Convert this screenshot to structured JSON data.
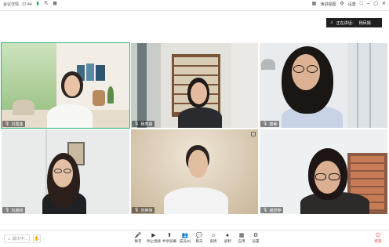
{
  "titlebar": {
    "meeting_label": "会议详情",
    "time": "37:44",
    "right_view_label": "演讲视图",
    "right_settings_label": "设置"
  },
  "speaking": {
    "label": "正在讲话：",
    "name": "杨凤娟"
  },
  "participants": [
    {
      "name": "刘霞莲"
    },
    {
      "name": "杨秀娟"
    },
    {
      "name": "唐睿"
    },
    {
      "name": "刘晨晓"
    },
    {
      "name": "刘英伟"
    },
    {
      "name": "谢舒婷"
    }
  ],
  "toolbar": {
    "chat_placeholder": "聊天中...",
    "tools": [
      {
        "label": "静音",
        "icon": "microphone-icon"
      },
      {
        "label": "停止视频",
        "icon": "video-icon"
      },
      {
        "label": "共享屏幕",
        "icon": "share-screen-icon"
      },
      {
        "label": "成员(6)",
        "icon": "members-icon"
      },
      {
        "label": "聊天",
        "icon": "chat-icon"
      },
      {
        "label": "表情",
        "icon": "reaction-icon"
      },
      {
        "label": "录制",
        "icon": "record-icon"
      },
      {
        "label": "应用",
        "icon": "apps-icon"
      },
      {
        "label": "设置",
        "icon": "settings-icon"
      }
    ],
    "leave_label": "结束"
  }
}
